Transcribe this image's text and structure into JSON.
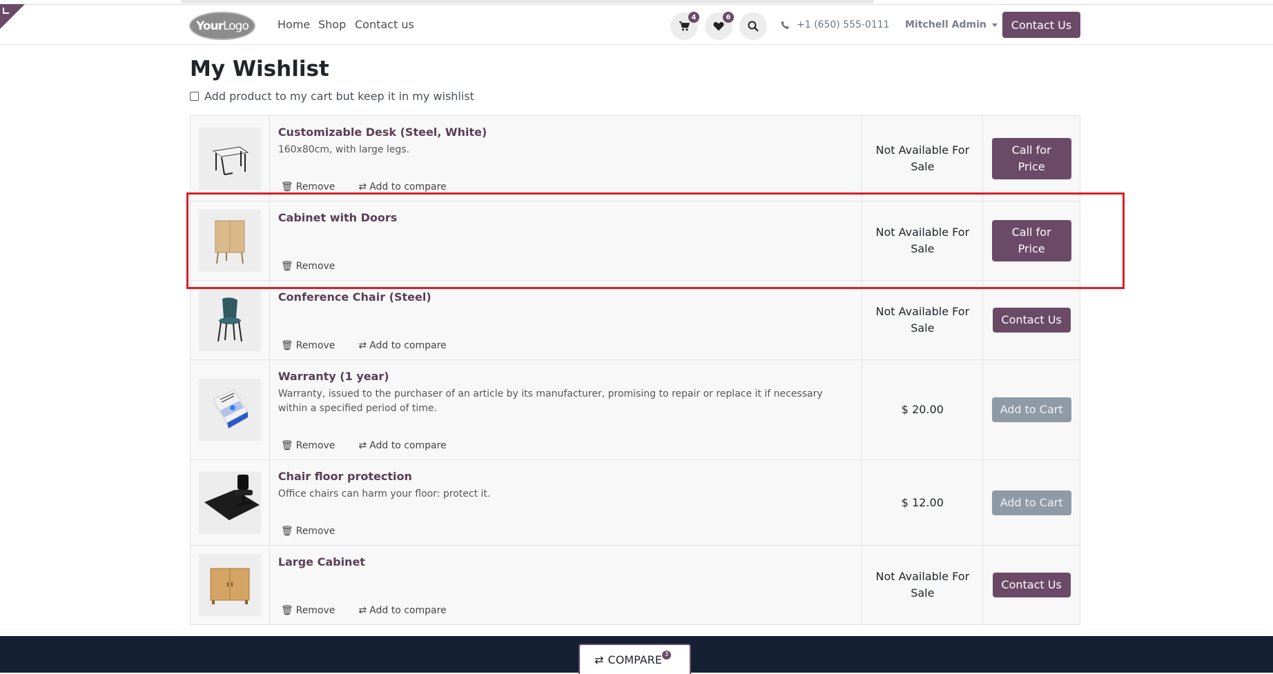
{
  "header": {
    "logo_your": "Your",
    "logo_logo": "Logo",
    "nav": {
      "home": "Home",
      "shop": "Shop",
      "contact": "Contact us"
    },
    "cart_count": "4",
    "wishlist_count": "6",
    "phone": "+1 (650) 555-0111",
    "user": "Mitchell Admin",
    "contact_button": "Contact Us"
  },
  "page": {
    "title": "My Wishlist",
    "keep_in_wishlist_label": "Add product to my cart but keep it in my wishlist"
  },
  "actions": {
    "remove": "Remove",
    "compare": "Add to compare"
  },
  "products": [
    {
      "name": "Customizable Desk (Steel, White)",
      "description": "160x80cm, with large legs.",
      "price": "Not Available For Sale",
      "button": "Call for Price",
      "icon": "desk-thumbnail"
    },
    {
      "name": "Cabinet with Doors",
      "description": "",
      "price": "Not Available For Sale",
      "button": "Call for Price",
      "icon": "cabinet-thumbnail"
    },
    {
      "name": "Conference Chair (Steel)",
      "description": "",
      "price": "Not Available For Sale",
      "button": "Contact Us",
      "icon": "chair-thumbnail"
    },
    {
      "name": "Warranty (1 year)",
      "description": "Warranty, issued to the purchaser of an article by its manufacturer, promising to repair or replace it if necessary within a specified period of time.",
      "price": "$ 20.00",
      "button": "Add to Cart",
      "icon": "warranty-box-thumbnail"
    },
    {
      "name": "Chair floor protection",
      "description": "Office chairs can harm your floor: protect it.",
      "price": "$ 12.00",
      "button": "Add to Cart",
      "icon": "floor-mat-thumbnail"
    },
    {
      "name": "Large Cabinet",
      "description": "",
      "price": "Not Available For Sale",
      "button": "Contact Us",
      "icon": "large-cabinet-thumbnail"
    }
  ],
  "compare": {
    "label": "COMPARE",
    "count": "3"
  },
  "colors": {
    "brand": "#6b4a68",
    "disabled_button": "#8e9aa6",
    "highlight": "#d81f26",
    "footer": "#152033"
  }
}
